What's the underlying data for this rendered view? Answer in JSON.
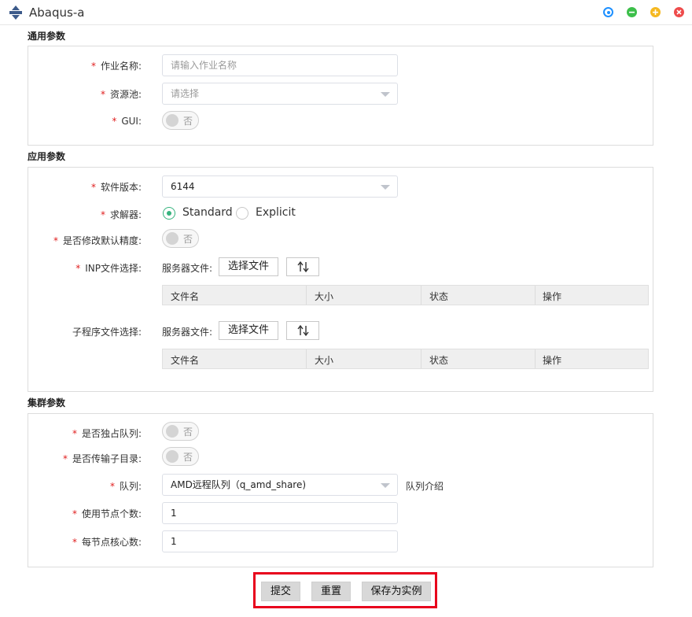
{
  "window": {
    "title": "Abaqus-a"
  },
  "sections": {
    "general": "通用参数",
    "app": "应用参数",
    "cluster": "集群参数"
  },
  "general": {
    "job_name_label": "作业名称:",
    "job_name_placeholder": "请输入作业名称",
    "pool_label": "资源池:",
    "pool_placeholder": "请选择",
    "gui_label": "GUI:",
    "gui_value": "否"
  },
  "app": {
    "version_label": "软件版本:",
    "version_value": "6144",
    "solver_label": "求解器:",
    "solver_options": [
      "Standard",
      "Explicit"
    ],
    "solver_selected": "Standard",
    "precision_label": "是否修改默认精度:",
    "precision_value": "否",
    "inp_label": "INP文件选择:",
    "sub_label": "子程序文件选择:",
    "server_file_label": "服务器文件:",
    "choose_file_button": "选择文件",
    "table_columns": [
      "文件名",
      "大小",
      "状态",
      "操作"
    ]
  },
  "cluster": {
    "exclusive_label": "是否独占队列:",
    "exclusive_value": "否",
    "transfer_label": "是否传输子目录:",
    "transfer_value": "否",
    "queue_label": "队列:",
    "queue_value": "AMD远程队列（q_amd_share)",
    "queue_intro": "队列介绍",
    "nodes_label": "使用节点个数:",
    "nodes_value": "1",
    "cores_label": "每节点核心数:",
    "cores_value": "1"
  },
  "actions": {
    "submit": "提交",
    "reset": "重置",
    "save_instance": "保存为实例"
  },
  "colors": {
    "required": "#e02020",
    "radio_checked": "#36b37e",
    "highlight_box": "#e8001c"
  },
  "icons": {
    "app": "abaqus-logo-icon",
    "window_controls": [
      "target-icon",
      "minimize-icon",
      "maximize-icon",
      "close-icon"
    ],
    "sort": "sort-arrows-icon",
    "select": "chevron-down-icon"
  }
}
